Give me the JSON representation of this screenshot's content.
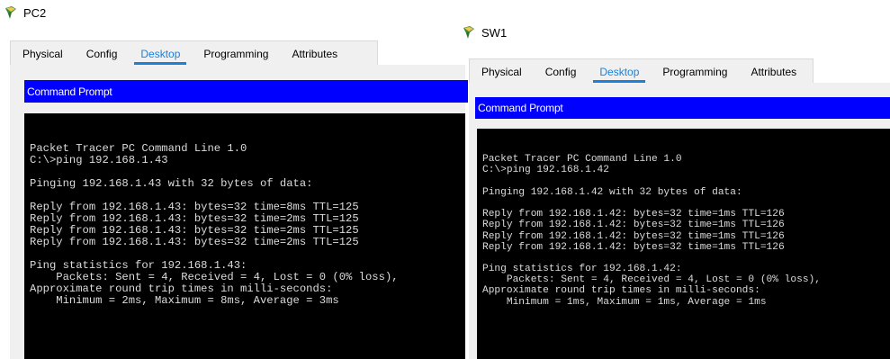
{
  "pc2": {
    "title": "PC2",
    "tabs": [
      "Physical",
      "Config",
      "Desktop",
      "Programming",
      "Attributes"
    ],
    "active_tab": "Desktop",
    "panel_title": "Command Prompt",
    "lines": [
      "",
      "Packet Tracer PC Command Line 1.0",
      "C:\\>ping 192.168.1.43",
      "",
      "Pinging 192.168.1.43 with 32 bytes of data:",
      "",
      "Reply from 192.168.1.43: bytes=32 time=8ms TTL=125",
      "Reply from 192.168.1.43: bytes=32 time=2ms TTL=125",
      "Reply from 192.168.1.43: bytes=32 time=2ms TTL=125",
      "Reply from 192.168.1.43: bytes=32 time=2ms TTL=125",
      "",
      "Ping statistics for 192.168.1.43:",
      "    Packets: Sent = 4, Received = 4, Lost = 0 (0% loss),",
      "Approximate round trip times in milli-seconds:",
      "    Minimum = 2ms, Maximum = 8ms, Average = 3ms"
    ]
  },
  "sw1": {
    "title": "SW1",
    "tabs": [
      "Physical",
      "Config",
      "Desktop",
      "Programming",
      "Attributes"
    ],
    "active_tab": "Desktop",
    "panel_title": "Command Prompt",
    "lines": [
      "",
      "Packet Tracer PC Command Line 1.0",
      "C:\\>ping 192.168.1.42",
      "",
      "Pinging 192.168.1.42 with 32 bytes of data:",
      "",
      "Reply from 192.168.1.42: bytes=32 time=1ms TTL=126",
      "Reply from 192.168.1.42: bytes=32 time=1ms TTL=126",
      "Reply from 192.168.1.42: bytes=32 time=1ms TTL=126",
      "Reply from 192.168.1.42: bytes=32 time=1ms TTL=126",
      "",
      "Ping statistics for 192.168.1.42:",
      "    Packets: Sent = 4, Received = 4, Lost = 0 (0% loss),",
      "Approximate round trip times in milli-seconds:",
      "    Minimum = 1ms, Maximum = 1ms, Average = 1ms"
    ]
  },
  "colors": {
    "accent": "#1d7fd6",
    "header_blue": "#0000ff",
    "terminal_bg": "#000000",
    "terminal_fg": "#dcdcdc"
  },
  "icons": {
    "app": "packet-tracer-device-icon"
  }
}
